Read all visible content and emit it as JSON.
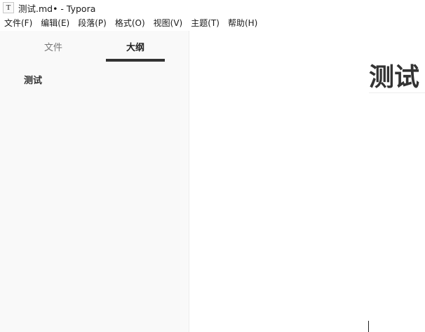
{
  "window": {
    "title": "测试.md• - Typora",
    "app_icon": "typora-icon",
    "app_icon_glyph": "T"
  },
  "menubar": {
    "items": [
      {
        "label": "文件(F)"
      },
      {
        "label": "编辑(E)"
      },
      {
        "label": "段落(P)"
      },
      {
        "label": "格式(O)"
      },
      {
        "label": "视图(V)"
      },
      {
        "label": "主题(T)"
      },
      {
        "label": "帮助(H)"
      }
    ]
  },
  "sidebar": {
    "tabs": [
      {
        "label": "文件",
        "active": false
      },
      {
        "label": "大纲",
        "active": true
      }
    ],
    "outline": [
      {
        "label": "测试",
        "level": 1
      }
    ]
  },
  "editor": {
    "heading": "测试"
  },
  "colors": {
    "sidebar_bg": "#f9f9f9",
    "active_tab_underline": "#333333",
    "text": "#333333"
  }
}
